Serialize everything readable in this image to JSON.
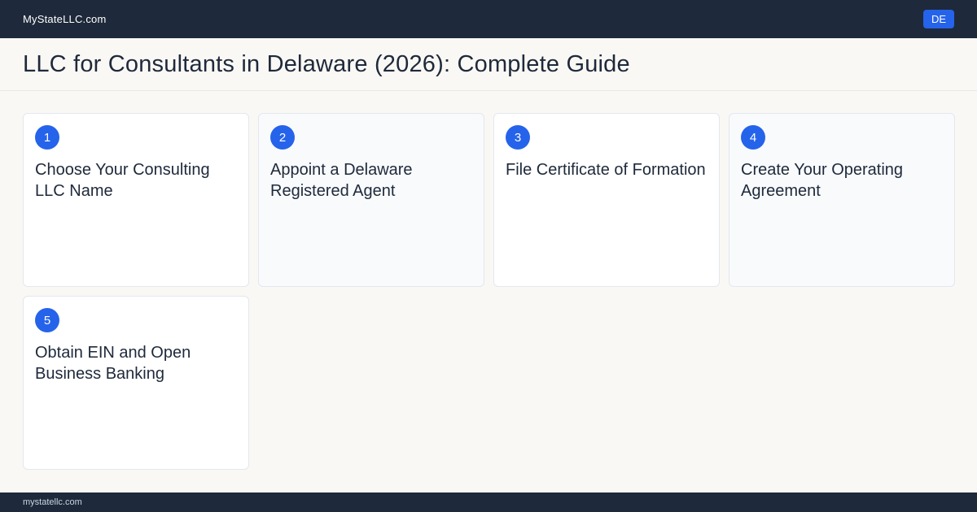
{
  "header": {
    "brand": "MyStateLLC.com",
    "state_badge": "DE"
  },
  "page": {
    "title": "LLC for Consultants in Delaware (2026): Complete Guide"
  },
  "steps": [
    {
      "number": "1",
      "title": "Choose Your Consulting LLC Name"
    },
    {
      "number": "2",
      "title": "Appoint a Delaware Registered Agent"
    },
    {
      "number": "3",
      "title": "File Certificate of Formation"
    },
    {
      "number": "4",
      "title": "Create Your Operating Agreement"
    },
    {
      "number": "5",
      "title": "Obtain EIN and Open Business Banking"
    }
  ],
  "footer": {
    "domain": "mystatellc.com"
  },
  "colors": {
    "nav_bg": "#1e293b",
    "accent": "#2563eb",
    "page_bg": "#faf8f4"
  }
}
